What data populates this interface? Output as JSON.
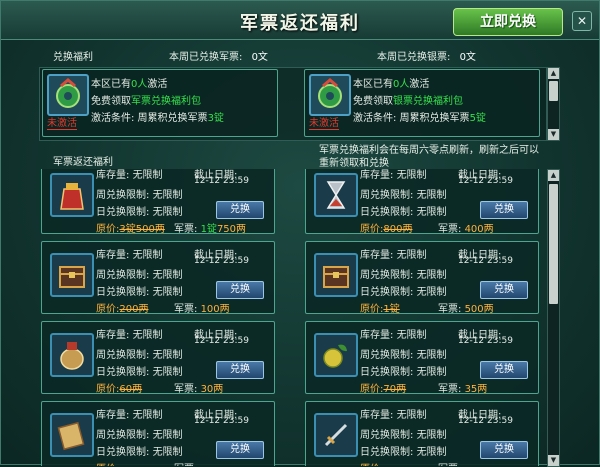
{
  "title": "军票返还福利",
  "redeem_button": "立即兑换",
  "close_button": "✕",
  "summary": {
    "exchange_benefits": "兑换福利",
    "week_tickets_label": "本周已兑换军票:",
    "week_tickets_value": "0文",
    "week_silver_label": "本周已兑换银票:",
    "week_silver_value": "0文"
  },
  "benefit_cards": [
    {
      "activated_prefix": "本区已有",
      "activated_count": "0人",
      "activated_suffix": "激活",
      "free_prefix": "免费领取",
      "pack_name": "军票兑换福利包",
      "cond_prefix": "激活条件: 周累积兑换军票",
      "cond_amount": "3锭",
      "status": "未激活",
      "icon": "jade-pendant-icon"
    },
    {
      "activated_prefix": "本区已有",
      "activated_count": "0人",
      "activated_suffix": "激活",
      "free_prefix": "免费领取",
      "pack_name": "银票兑换福利包",
      "cond_prefix": "激活条件: 周累积兑换军票",
      "cond_amount": "5锭",
      "status": "未激活",
      "icon": "jade-pendant-icon"
    }
  ],
  "returns_header": "军票返还福利",
  "notice": "军票兑换福利会在每周六零点刷新，刷新之后可以重新领取和兑换",
  "labels": {
    "stock": "库存量:",
    "unlimited": "无限制",
    "deadline": "截止日期:",
    "weekly_limit": "周兑换限制:",
    "daily_limit": "日兑换限制:",
    "exchange": "兑换",
    "original_price": "原价:",
    "tickets": "军票:"
  },
  "items": [
    {
      "icon": "red-pouch-icon",
      "date": "12-12 23:59",
      "original_price": "3锭500两",
      "tickets_a": "1锭",
      "tickets_b": "750两"
    },
    {
      "icon": "hourglass-icon",
      "date": "12-12 23:59",
      "original_price": "800两",
      "tickets_a": "",
      "tickets_b": "400两"
    },
    {
      "icon": "treasure-chest-icon",
      "date": "12-12 23:59",
      "original_price": "200两",
      "tickets_a": "",
      "tickets_b": "100两"
    },
    {
      "icon": "treasure-chest-icon",
      "date": "12-12 23:59",
      "original_price": "1锭",
      "tickets_a": "",
      "tickets_b": "500两"
    },
    {
      "icon": "wine-jar-icon",
      "date": "12-12 23:59",
      "original_price": "60两",
      "tickets_a": "",
      "tickets_b": "30两"
    },
    {
      "icon": "fruit-icon",
      "date": "12-12 23:59",
      "original_price": "70两",
      "tickets_a": "",
      "tickets_b": "35两"
    },
    {
      "icon": "scroll-icon",
      "date": "12-12 23:59",
      "original_price": "",
      "tickets_a": "",
      "tickets_b": ""
    },
    {
      "icon": "sword-icon",
      "date": "12-12 23:59",
      "original_price": "",
      "tickets_a": "",
      "tickets_b": ""
    }
  ]
}
